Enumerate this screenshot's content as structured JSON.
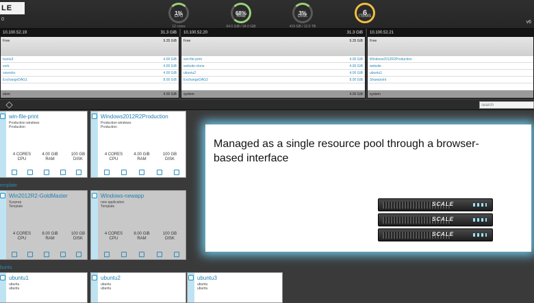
{
  "header": {
    "logo": "LE",
    "left_sub": "0",
    "version": "v6",
    "gauges": [
      {
        "value": "1%",
        "label": "CPU",
        "sub": "12 cores"
      },
      {
        "value": "68%",
        "label": "RAM",
        "sub": "64.0 GiB / 94.0 GiB"
      },
      {
        "value": "3%",
        "label": "DISK",
        "sub": "419 GB / 12.0 TB"
      },
      {
        "value": "6",
        "label": "ITEMS",
        "sub": ""
      }
    ]
  },
  "nodes": [
    {
      "ip": "10.100.52.19",
      "total": "31.3 GiB",
      "free_label": "Free",
      "free_value": "9.35 GiB",
      "vms": [
        {
          "name": "buntu3",
          "size": "4.00 GiB"
        },
        {
          "name": "vork",
          "size": "4.00 GiB"
        },
        {
          "name": "ceworks",
          "size": "4.00 GiB"
        },
        {
          "name": "ExchangeDAG1",
          "size": "8.00 GiB"
        }
      ],
      "system_label": "stem",
      "system_value": "4.00 GiB"
    },
    {
      "ip": "10.100.52.20",
      "total": "31.3 GiB",
      "free_label": "Free",
      "free_value": "9.35 GiB",
      "vms": [
        {
          "name": "win-file-print",
          "size": "4.00 GiB"
        },
        {
          "name": "website-clone",
          "size": "4.00 GiB"
        },
        {
          "name": "ubuntu2",
          "size": "4.00 GiB"
        },
        {
          "name": "ExchangeDAG2",
          "size": "8.00 GiB"
        }
      ],
      "system_label": "system",
      "system_value": "4.00 GiB"
    },
    {
      "ip": "10.100.52.21",
      "total": "",
      "free_label": "Free",
      "free_value": "",
      "vms": [
        {
          "name": "Windows2012R2Production",
          "size": ""
        },
        {
          "name": "website",
          "size": ""
        },
        {
          "name": "ubuntu1",
          "size": ""
        },
        {
          "name": "Sharepoint",
          "size": ""
        }
      ],
      "system_label": "system",
      "system_value": ""
    }
  ],
  "toolbar": {
    "search_placeholder": "search"
  },
  "sections": {
    "template": "emplate",
    "ubuntu": "buntu"
  },
  "cards": [
    {
      "title": "win-file-print",
      "desc1": "Production windows",
      "desc2": "Production",
      "cpu": "4 CORES",
      "ram": "4.00 GiB",
      "disk": "100 GB"
    },
    {
      "title": "Windows2012R2Production",
      "desc1": "Production windows",
      "desc2": "Production",
      "cpu": "4 CORES",
      "ram": "4.00 GiB",
      "disk": "100 GB"
    },
    {
      "title": "Win2012R2-GoldMaster",
      "desc1": "Sysprep",
      "desc2": "Template",
      "cpu": "4 CORES",
      "ram": "8.00 GiB",
      "disk": "100 GB"
    },
    {
      "title": "Windows-newapp",
      "desc1": "new application",
      "desc2": "Template",
      "cpu": "4 CORES",
      "ram": "8.00 GiB",
      "disk": "100 GB"
    },
    {
      "title": "ubuntu1",
      "desc1": "ubuntu",
      "desc2": "ubuntu"
    },
    {
      "title": "ubuntu2",
      "desc1": "ubuntu",
      "desc2": "ubuntu"
    },
    {
      "title": "ubuntu3",
      "desc1": "ubuntu",
      "desc2": "ubuntu"
    }
  ],
  "stat_units": {
    "cpu": "CPU",
    "ram": "RAM",
    "disk": "DISK"
  },
  "callout": {
    "text": "Managed as a single resource pool through a browser-based interface",
    "server_brand": "SCALE"
  },
  "colors": {
    "accent": "#2a8ab8",
    "glow": "#6fc7e8",
    "items_ring": "#f0c040",
    "gauge_ok": "#9bd27a"
  }
}
